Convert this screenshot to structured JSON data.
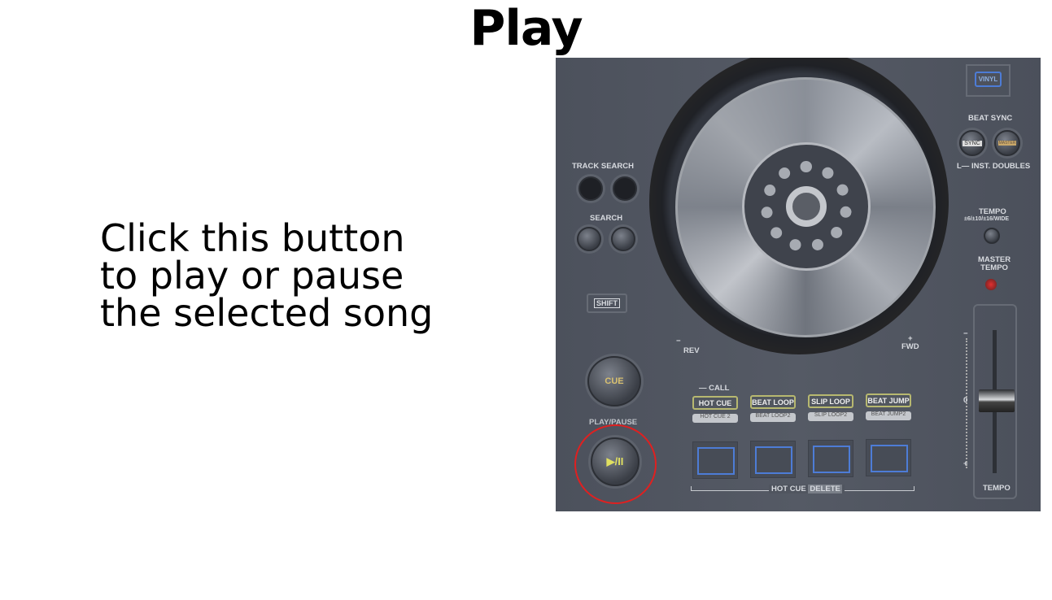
{
  "title": "Play",
  "description": [
    "Click this button",
    "to play or pause",
    "the selected song"
  ],
  "controller": {
    "jog_mode": "VINYL",
    "beat_sync": "BEAT SYNC",
    "sync": "SYNC",
    "master": "MASTER",
    "inst_doubles": "INST. DOUBLES",
    "track_search": "TRACK SEARCH",
    "search": "SEARCH",
    "shift": "SHIFT",
    "tempo_range": "TEMPO",
    "tempo_range_values": "±6/±10/±16/WIDE",
    "master_tempo": [
      "MASTER",
      "TEMPO"
    ],
    "rev": "REV",
    "fwd": "FWD",
    "minus": "−",
    "plus": "+",
    "cue": "CUE",
    "play_pause_label": "PLAY/PAUSE",
    "play_pause_glyph": "▶/II",
    "call": "CALL",
    "pad_modes": [
      {
        "label": "HOT CUE",
        "shift": "HOT CUE 2"
      },
      {
        "label": "BEAT LOOP",
        "shift": "BEAT LOOP2"
      },
      {
        "label": "SLIP LOOP",
        "shift": "SLIP LOOP2"
      },
      {
        "label": "BEAT JUMP",
        "shift": "BEAT JUMP2"
      }
    ],
    "hot_cue": "HOT CUE",
    "delete": "DELETE",
    "tempo_zero": "0",
    "tempo_label": "TEMPO",
    "highlight_color": "#e02020",
    "accent_yellow": "#d8d070"
  }
}
